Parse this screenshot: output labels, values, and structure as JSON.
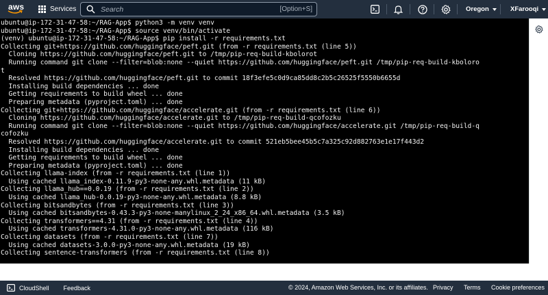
{
  "topbar": {
    "logo_text": "aws",
    "services_label": "Services",
    "search_placeholder": "Search",
    "search_shortcut": "[Option+S]",
    "region": "Oregon",
    "account": "XFarooqi",
    "icons": [
      "terminal-icon",
      "bell-icon",
      "help-icon",
      "gear-icon"
    ],
    "bg_color": "#232f3e"
  },
  "terminal": {
    "lines": [
      "ubuntu@ip-172-31-47-58:~/RAG-App$ python3 -m venv venv",
      "ubuntu@ip-172-31-47-58:~/RAG-App$ source venv/bin/activate",
      "(venv) ubuntu@ip-172-31-47-58:~/RAG-App$ pip install -r requirements.txt",
      "Collecting git+https://github.com/huggingface/peft.git (from -r requirements.txt (line 5))",
      "  Cloning https://github.com/huggingface/peft.git to /tmp/pip-req-build-kbolorot",
      "  Running command git clone --filter=blob:none --quiet https://github.com/huggingface/peft.git /tmp/pip-req-build-kboloro",
      "t",
      "  Resolved https://github.com/huggingface/peft.git to commit 18f3efe5c0d9ca85dd8c2b5c26525f5550b6655d",
      "  Installing build dependencies ... done",
      "  Getting requirements to build wheel ... done",
      "  Preparing metadata (pyproject.toml) ... done",
      "Collecting git+https://github.com/huggingface/accelerate.git (from -r requirements.txt (line 6))",
      "  Cloning https://github.com/huggingface/accelerate.git to /tmp/pip-req-build-qcofozku",
      "  Running command git clone --filter=blob:none --quiet https://github.com/huggingface/accelerate.git /tmp/pip-req-build-q",
      "cofozku",
      "  Resolved https://github.com/huggingface/accelerate.git to commit 521eb5bee45b5c7a325c92d882763e1e17f443d2",
      "  Installing build dependencies ... done",
      "  Getting requirements to build wheel ... done",
      "  Preparing metadata (pyproject.toml) ... done",
      "Collecting llama-index (from -r requirements.txt (line 1))",
      "  Using cached llama_index-0.11.9-py3-none-any.whl.metadata (11 kB)",
      "Collecting llama_hub==0.0.19 (from -r requirements.txt (line 2))",
      "  Using cached llama_hub-0.0.19-py3-none-any.whl.metadata (8.8 kB)",
      "Collecting bitsandbytes (from -r requirements.txt (line 3))",
      "  Using cached bitsandbytes-0.43.3-py3-none-manylinux_2_24_x86_64.whl.metadata (3.5 kB)",
      "Collecting transformers==4.31 (from -r requirements.txt (line 4))",
      "  Using cached transformers-4.31.0-py3-none-any.whl.metadata (116 kB)",
      "Collecting datasets (from -r requirements.txt (line 7))",
      "  Using cached datasets-3.0.0-py3-none-any.whl.metadata (19 kB)",
      "Collecting sentence-transformers (from -r requirements.txt (line 8))"
    ]
  },
  "side_panel": {
    "icon": "settings-gear-icon"
  },
  "footer": {
    "cloudshell_label": "CloudShell",
    "feedback_label": "Feedback",
    "copyright": "© 2024, Amazon Web Services, Inc. or its affiliates.",
    "privacy_label": "Privacy",
    "terms_label": "Terms",
    "cookie_label": "Cookie preferences"
  }
}
